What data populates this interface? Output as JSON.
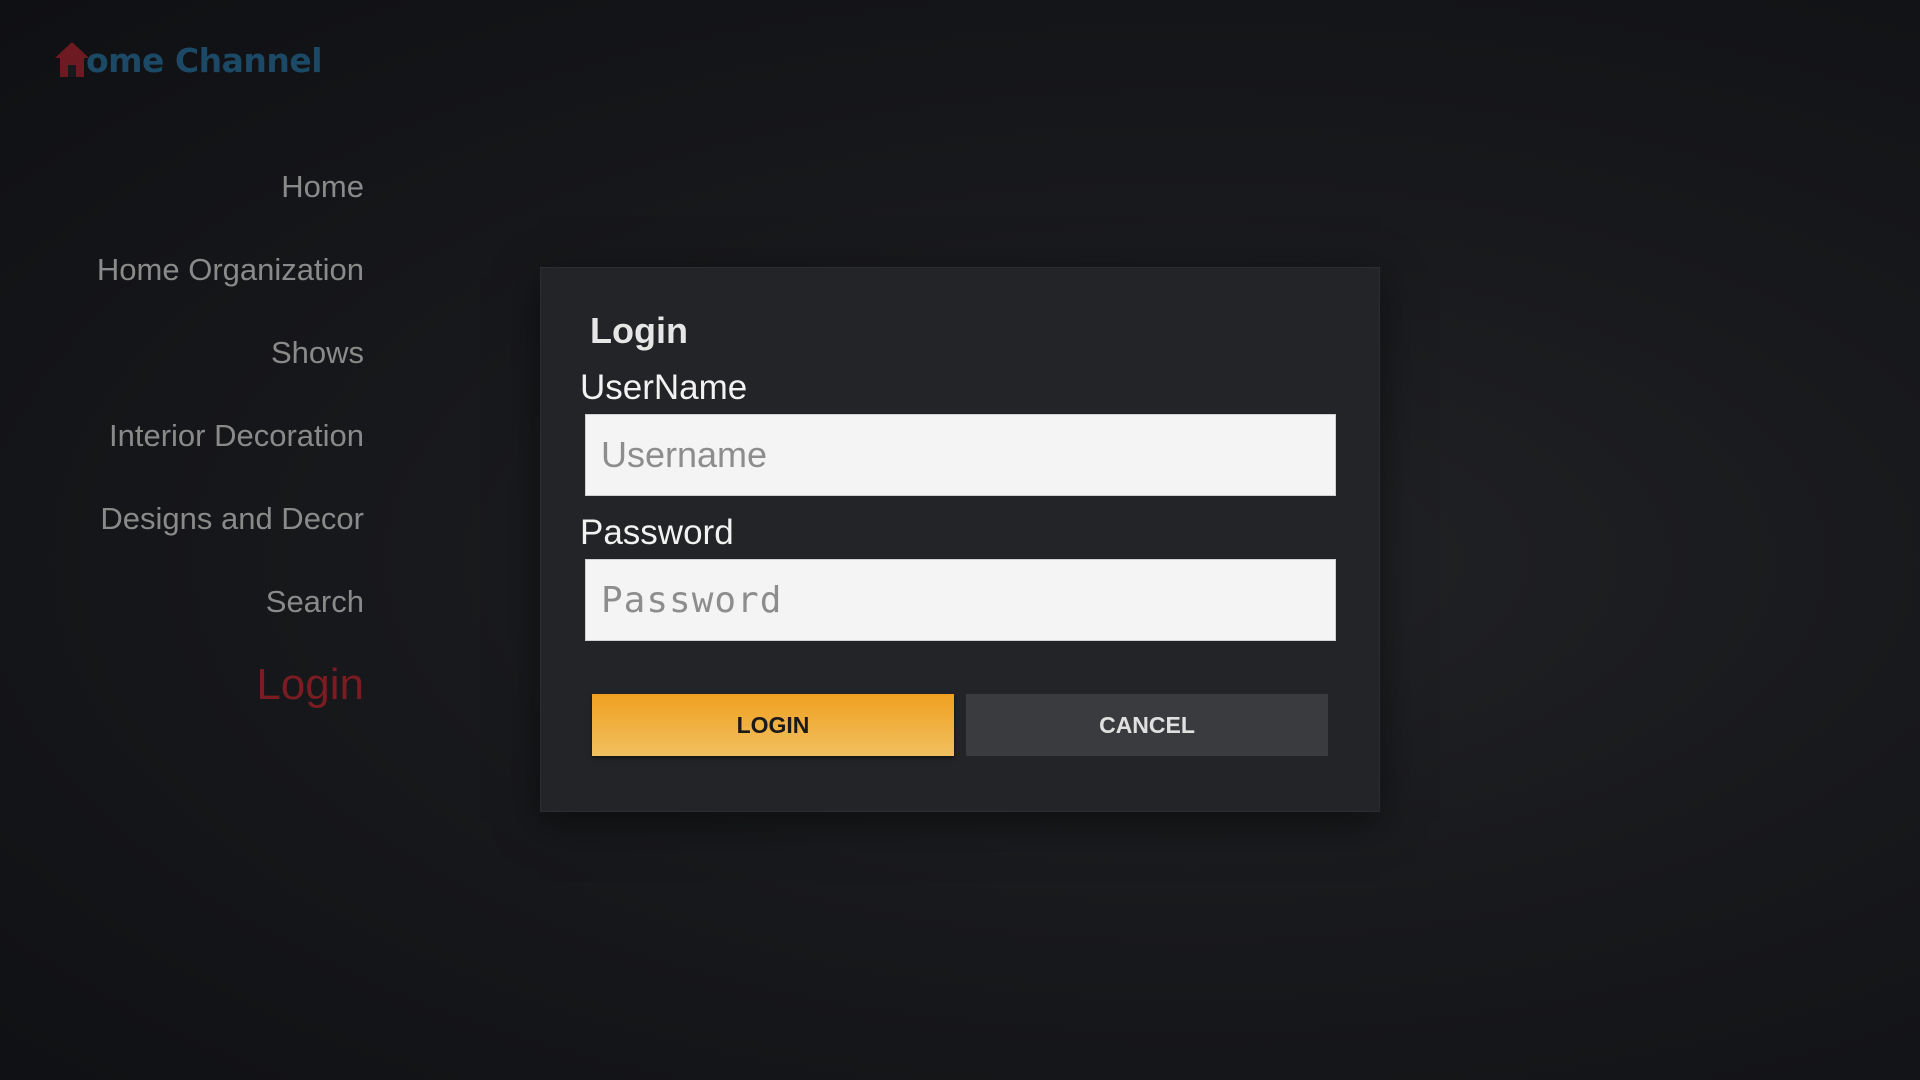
{
  "app": {
    "logo_text": "ome Channel",
    "logo_icon": "house-icon"
  },
  "nav": {
    "items": [
      {
        "label": "Home"
      },
      {
        "label": "Home Organization"
      },
      {
        "label": "Shows"
      },
      {
        "label": "Interior Decoration"
      },
      {
        "label": "Designs and Decor"
      },
      {
        "label": "Search"
      },
      {
        "label": "Login",
        "active": true
      }
    ]
  },
  "login_dialog": {
    "title": "Login",
    "username_label": "UserName",
    "username_placeholder": "Username",
    "username_value": "",
    "password_label": "Password",
    "password_placeholder": "Password",
    "password_value": "",
    "login_button": "LOGIN",
    "cancel_button": "CANCEL"
  },
  "colors": {
    "accent_orange": "#f0a020",
    "active_nav": "#7a1c22",
    "logo_blue": "#1c4a66"
  }
}
